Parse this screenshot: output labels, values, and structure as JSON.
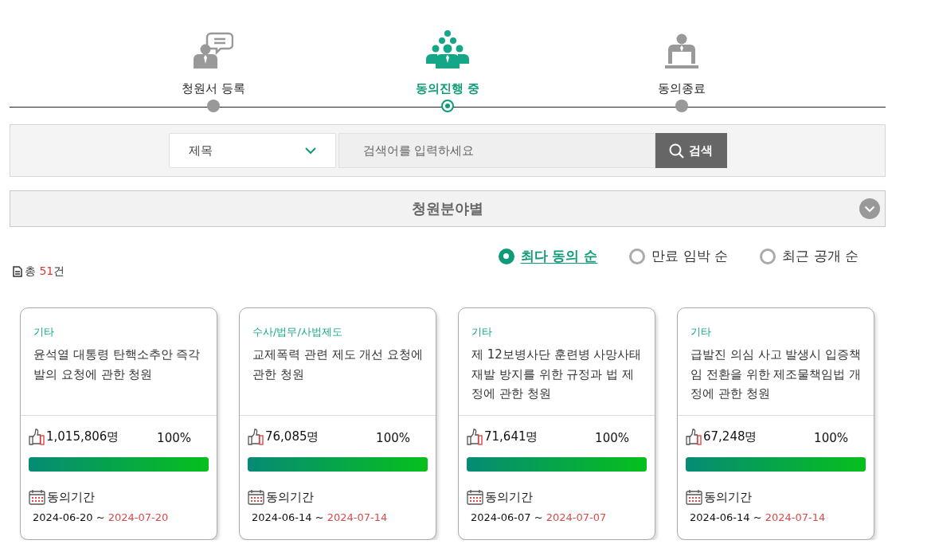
{
  "steps": [
    {
      "kind": "register",
      "label": "청원서 등록",
      "selected": false
    },
    {
      "kind": "progress",
      "label": "동의진행 중",
      "selected": true
    },
    {
      "kind": "closed",
      "label": "동의종료",
      "selected": false
    }
  ],
  "search": {
    "field_select": "제목",
    "placeholder": "검색어를 입력하세요",
    "button": "검색"
  },
  "category_filter": {
    "label": "청원분야별"
  },
  "total": {
    "prefix": "총 ",
    "count": "51",
    "suffix": "건"
  },
  "sort_options": [
    {
      "label": "최다 동의 순",
      "selected": true
    },
    {
      "label": "만료 임박 순",
      "selected": false
    },
    {
      "label": "최근 공개 순",
      "selected": false
    }
  ],
  "petitions": [
    {
      "category": "기타",
      "title": "윤석열 대통령 탄핵소추안 즉각 발의 요청에 관한 청원",
      "count": "1,015,806명",
      "percent": "100%",
      "level": 1,
      "period_label": "동의기간",
      "start": "2024-06-20",
      "separator": " ~ ",
      "end": "2024-07-20"
    },
    {
      "category": "수사/법무/사법제도",
      "title": "교제폭력 관련 제도 개선 요청에 관한 청원",
      "count": "76,085명",
      "percent": "100%",
      "level": 1,
      "period_label": "동의기간",
      "start": "2024-06-14",
      "separator": " ~ ",
      "end": "2024-07-14"
    },
    {
      "category": "기타",
      "title": "제 12보병사단 훈련병 사망사태 재발 방지를 위한 규정과 법 제정에 관한 청원",
      "count": "71,641명",
      "percent": "100%",
      "level": 1,
      "period_label": "동의기간",
      "start": "2024-06-07",
      "separator": " ~ ",
      "end": "2024-07-07"
    },
    {
      "category": "기타",
      "title": "급발진 의심 사고 발생시 입증책임 전환을 위한 제조물책임법 개정에 관한 청원",
      "count": "67,248명",
      "percent": "100%",
      "level": 1,
      "period_label": "동의기간",
      "start": "2024-06-14",
      "separator": " ~ ",
      "end": "2024-07-14"
    }
  ]
}
